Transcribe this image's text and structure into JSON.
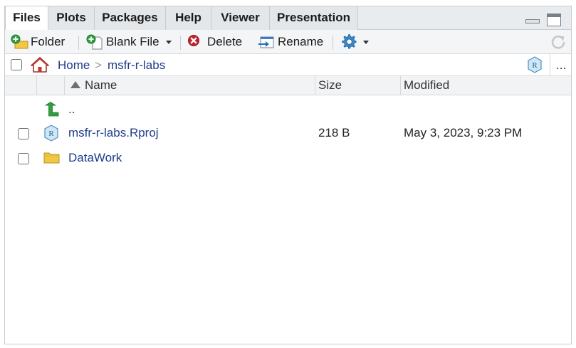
{
  "tabs": [
    {
      "label": "Files",
      "active": true
    },
    {
      "label": "Plots",
      "active": false
    },
    {
      "label": "Packages",
      "active": false
    },
    {
      "label": "Help",
      "active": false
    },
    {
      "label": "Viewer",
      "active": false
    },
    {
      "label": "Presentation",
      "active": false
    }
  ],
  "toolbar": {
    "new_folder_label": "Folder",
    "blank_file_label": "Blank File",
    "delete_label": "Delete",
    "rename_label": "Rename",
    "icons": [
      "new-folder-icon",
      "new-blank-file-icon",
      "delete-icon",
      "rename-icon",
      "gear-icon",
      "refresh-icon"
    ]
  },
  "breadcrumb": {
    "home": "Home",
    "separator": ">",
    "current": "msfr-r-labs",
    "more": "..."
  },
  "columns": {
    "name": "Name",
    "size": "Size",
    "modified": "Modified",
    "sort": "name-ascending"
  },
  "rows": [
    {
      "name": "..",
      "size": "",
      "modified": "",
      "icon": "up-arrow-icon",
      "checkbox": false
    },
    {
      "name": "msfr-r-labs.Rproj",
      "size": "218 B",
      "modified": "May 3, 2023, 9:23 PM",
      "icon": "rproj-icon",
      "checkbox": true
    },
    {
      "name": "DataWork",
      "size": "",
      "modified": "",
      "icon": "folder-icon",
      "checkbox": true
    }
  ],
  "colors": {
    "link": "#1f3c8a",
    "tab_bg": "#e4e7ea",
    "accent_green": "#2e9e3e",
    "accent_red": "#c0262d",
    "folder_yellow": "#f2c744"
  }
}
